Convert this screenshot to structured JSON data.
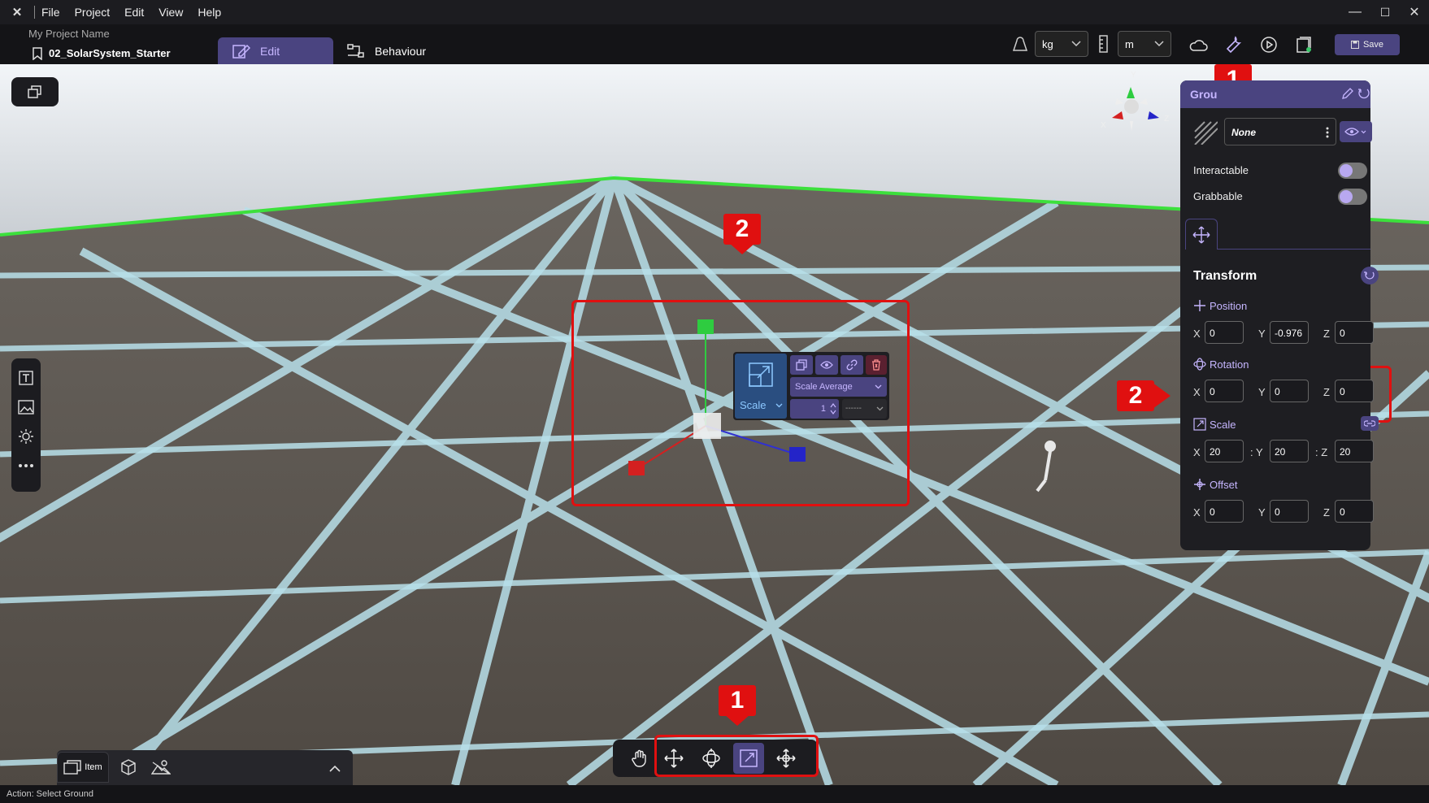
{
  "menu": {
    "items": [
      "File",
      "Project",
      "Edit",
      "View",
      "Help"
    ]
  },
  "window": {
    "minimize": "—",
    "maximize": "☐",
    "close": "✕"
  },
  "header": {
    "project_name": "My Project Name",
    "scene_name": "02_SolarSystem_Starter",
    "tabs": {
      "edit": "Edit",
      "behaviour": "Behaviour"
    },
    "mass_unit": "kg",
    "length_unit": "m",
    "save_label": "Save"
  },
  "gizmo": {
    "y": "Y",
    "x": "X",
    "z": "Z"
  },
  "popup": {
    "mode_label": "Scale",
    "scale_option": "Scale Average",
    "step_value": "1",
    "step_unit": "------"
  },
  "callouts": {
    "toolbar_callout": "1",
    "inspector_callout": "1",
    "object_callout": "2",
    "scale_callout": "2"
  },
  "inspector": {
    "title": "Grou",
    "material": "None",
    "interactable_label": "Interactable",
    "grabbable_label": "Grabbable",
    "interactable_on": true,
    "grabbable_on": true,
    "transform_title": "Transform",
    "position": {
      "label": "Position",
      "x": "0",
      "y": "-0.976",
      "z": "0"
    },
    "rotation": {
      "label": "Rotation",
      "x": "0",
      "y": "0",
      "z": "0"
    },
    "scale": {
      "label": "Scale",
      "x": "20",
      "y": "20",
      "z": "20"
    },
    "offset": {
      "label": "Offset",
      "x": "0",
      "y": "0",
      "z": "0"
    },
    "axis_x": "X",
    "axis_y": "Y",
    "axis_z": "Z",
    "scale_sep_y": ": Y",
    "scale_sep_z": ": Z"
  },
  "bottom_tabs": {
    "item_label": "Item"
  },
  "status": {
    "text": "Action: Select Ground"
  },
  "colors": {
    "accent": "#4a4480",
    "highlight": "#e01010",
    "lavender": "#c6b6ff",
    "grid": "#b8e0ea",
    "ground": "#55504b"
  }
}
